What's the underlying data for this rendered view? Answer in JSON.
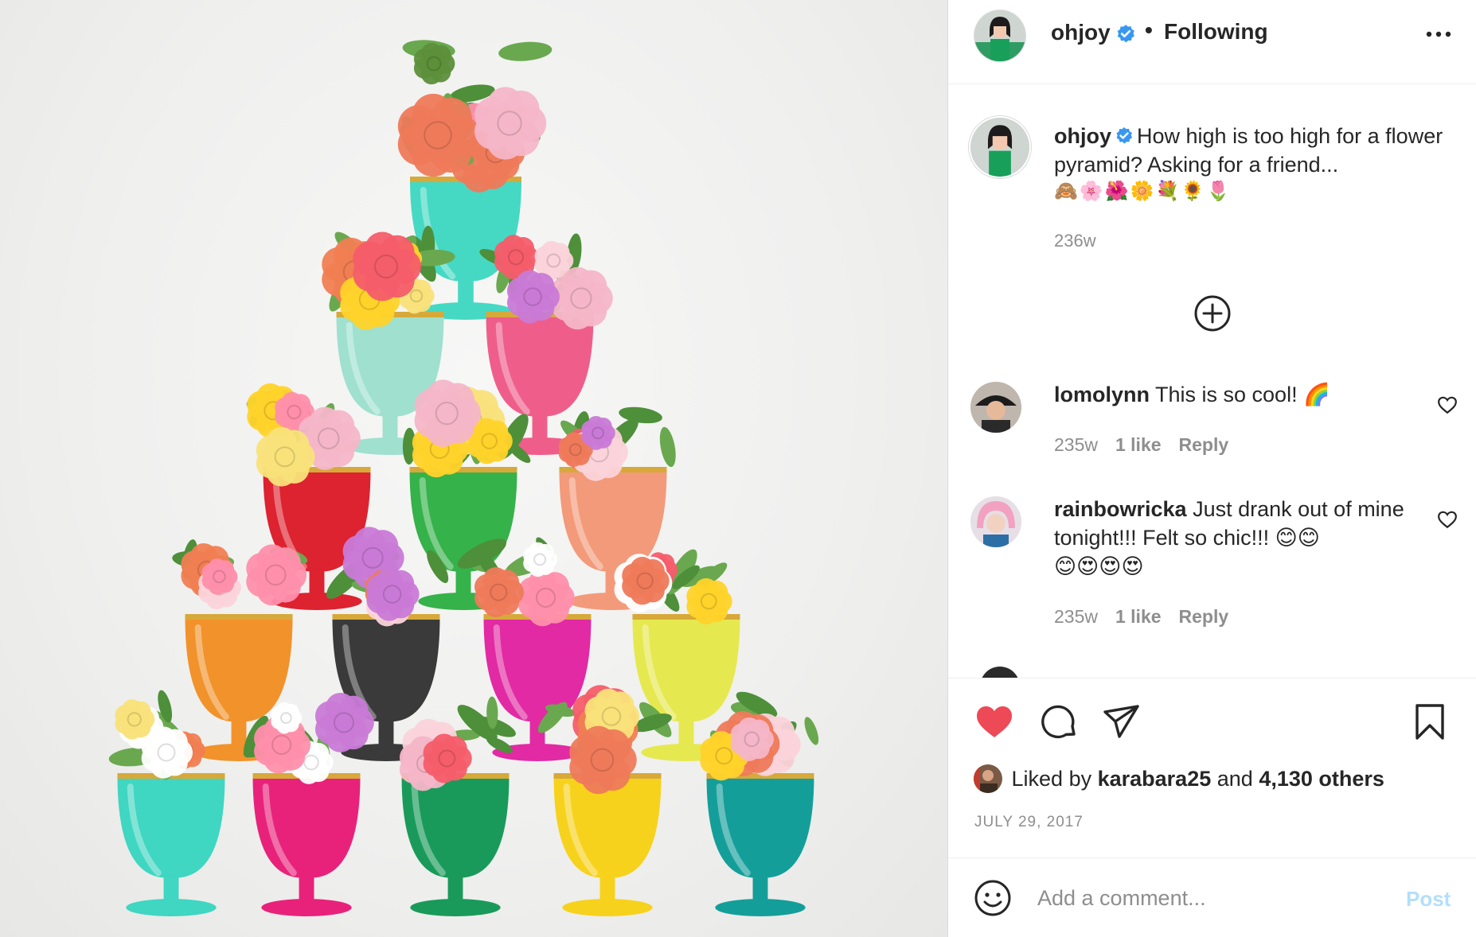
{
  "post": {
    "image_alt": "Pyramid of colorful goblets filled with flowers",
    "colors": {
      "background": "#efefee",
      "cups": [
        "#3fd6c2",
        "#e8227a",
        "#1a9a5a",
        "#f7d21c",
        "#149e9a",
        "#f2922b",
        "#3a3a3a",
        "#e12aa3",
        "#e6e84f",
        "#dd2230",
        "#35b24a",
        "#f39a7a",
        "#9fe0cf",
        "#ef5e8a",
        "#45d9c4"
      ]
    }
  },
  "header": {
    "username": "ohjoy",
    "separator": "•",
    "follow_status": "Following",
    "more_icon": "more-horizontal-icon"
  },
  "caption": {
    "username": "ohjoy",
    "text": "How high is too high for a flower pyramid? Asking for a friend...",
    "emojis": "🙈🌸🌺🌼💐🌻🌷",
    "timestamp": "236w"
  },
  "load_more_icon": "plus-circle-icon",
  "comments": [
    {
      "username": "lomolynn",
      "text": "This is so cool! 🌈",
      "time": "235w",
      "likes": "1 like",
      "reply": "Reply"
    },
    {
      "username": "rainbowricka",
      "text": "Just drank out of mine tonight!!! Felt so chic!!! 😊😊",
      "text2": "😊😍😍😍",
      "time": "235w",
      "likes": "1 like",
      "reply": "Reply"
    }
  ],
  "actions": {
    "liked_by_prefix": "Liked by",
    "liked_by_user": "karabara25",
    "liked_by_and": "and",
    "liked_by_others": "4,130 others",
    "date": "JULY 29, 2017",
    "like_color": "#ed4956"
  },
  "add_comment": {
    "placeholder": "Add a comment...",
    "post_label": "Post",
    "post_color": "#b2dffc"
  }
}
